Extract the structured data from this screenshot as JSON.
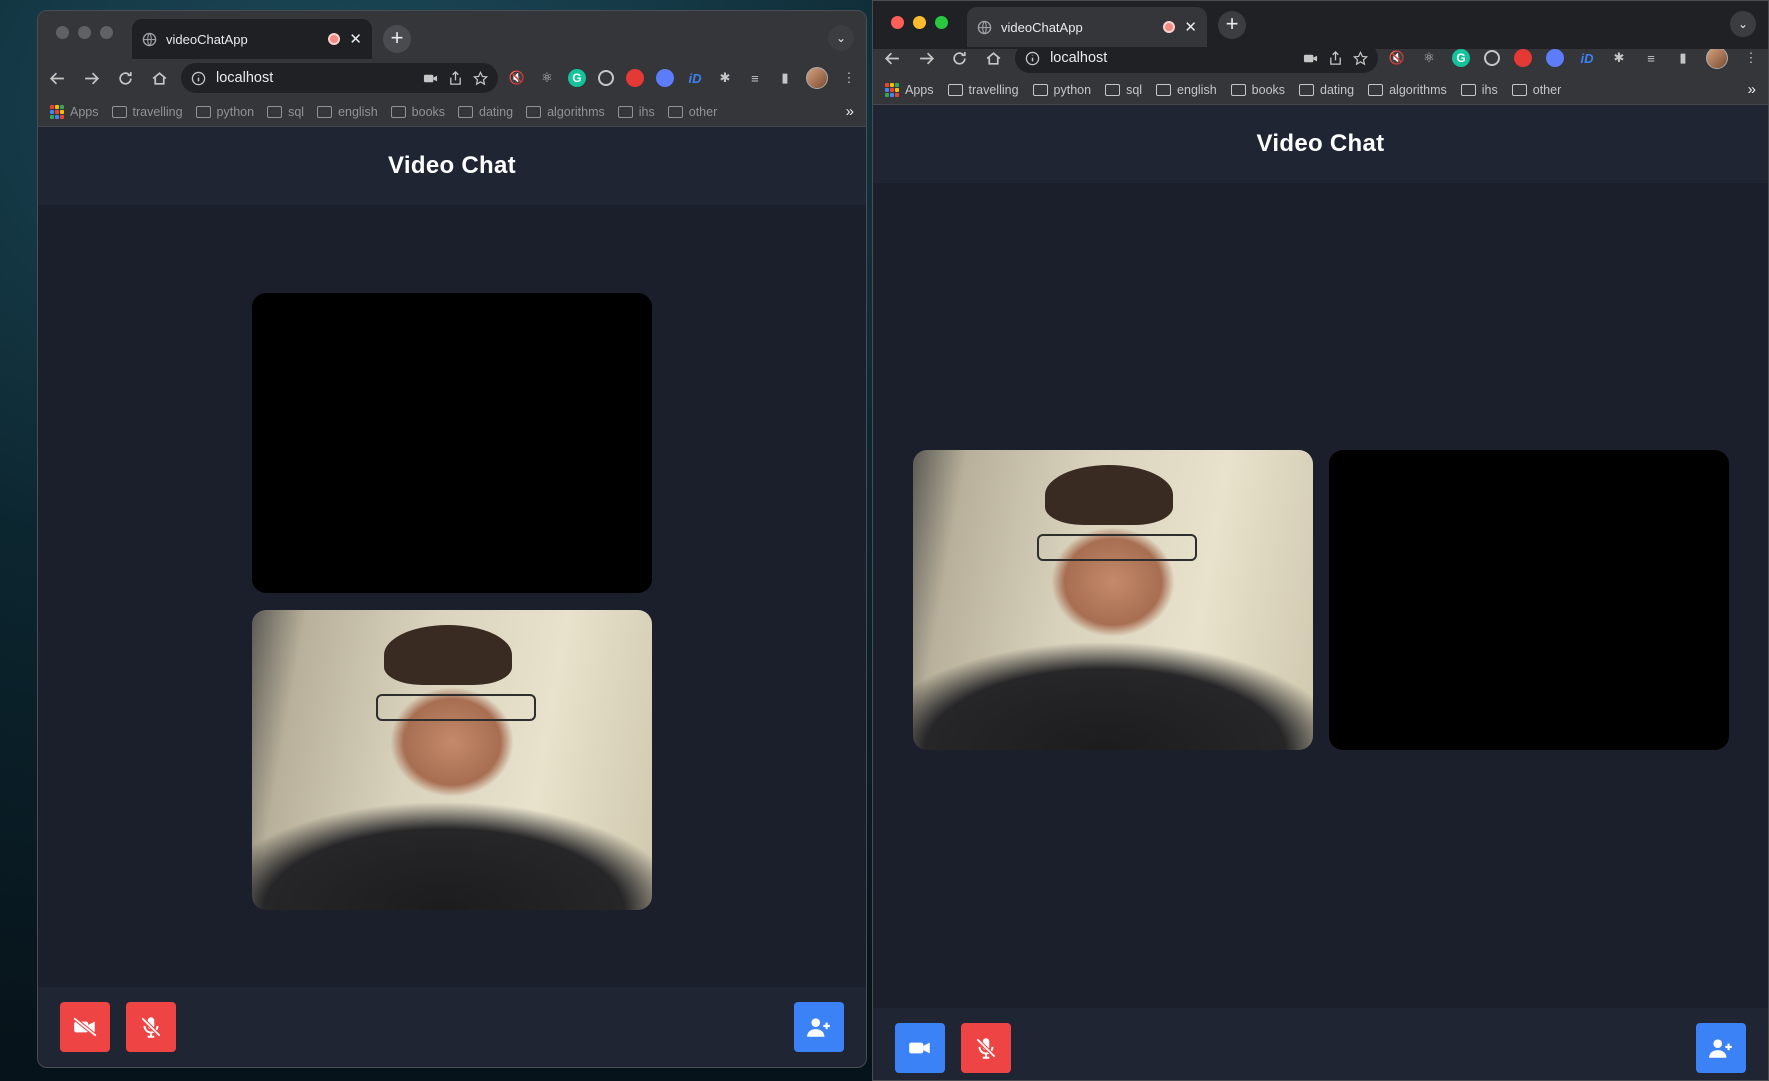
{
  "windows": {
    "left": {
      "tab_title": "videoChatApp",
      "url": "localhost",
      "bookmarks": [
        "Apps",
        "travelling",
        "python",
        "sql",
        "english",
        "books",
        "dating",
        "algorithms",
        "ihs",
        "other"
      ],
      "bookmarks_more": "»",
      "app_title": "Video Chat",
      "video_layout": "stacked",
      "camera_button_state": "off",
      "mic_button_state": "muted"
    },
    "right": {
      "tab_title": "videoChatApp",
      "url": "localhost",
      "bookmarks": [
        "Apps",
        "travelling",
        "python",
        "sql",
        "english",
        "books",
        "dating",
        "algorithms",
        "ihs",
        "other"
      ],
      "bookmarks_more": "»",
      "app_title": "Video Chat",
      "video_layout": "side-by-side",
      "camera_button_state": "on",
      "mic_button_state": "muted"
    }
  },
  "extensions": [
    "mute-icon",
    "react-icon",
    "grammarly-icon",
    "record-icon",
    "adblock-icon",
    "vpn-icon",
    "ip-icon",
    "puzzle-icon",
    "playlist-icon",
    "sidepanel-icon"
  ],
  "colors": {
    "app_bg": "#1a1f2b",
    "header_bg": "#1f2533",
    "danger": "#ef4444",
    "primary": "#3b82f6"
  }
}
